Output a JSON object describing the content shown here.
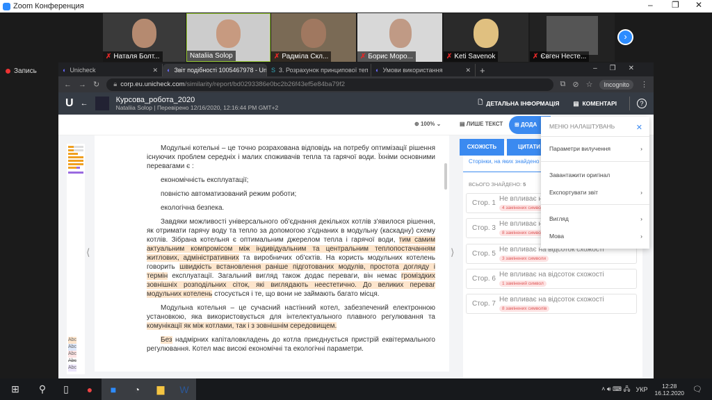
{
  "zoom": {
    "title": "Zoom Конференция",
    "record": "Запись",
    "participants": [
      "Наталя Болт...",
      "Nataliia Solop",
      "Радміла Скл...",
      "Борис Моро...",
      "Keti Savenok",
      "Євген Несте..."
    ]
  },
  "browser": {
    "tabs": [
      {
        "label": "Unicheck"
      },
      {
        "label": "Звіт подібності 1005467978 - Un"
      },
      {
        "label": "3. Розрахунок принципової теп"
      },
      {
        "label": "Умови використання"
      }
    ],
    "url_host": "corp.eu.unicheck.com",
    "url_path": "/similarity/report/bd0293386e0bc2b26f43ef5e84ba79f2",
    "incognito": "Incognito"
  },
  "app": {
    "doc_title": "Курсова_робота_2020",
    "doc_sub": "Nataliia Solop | Перевірено 12/16/2020, 12:16:44 PM GMT+2",
    "details": "ДЕТАЛЬНА ІНФОРМАЦІЯ",
    "comments": "КОМЕНТАРІ",
    "help": "?",
    "zoom_level": "100%",
    "text_only": "ЛИШЕ ТЕКСТ",
    "add": "ДОДА"
  },
  "document": {
    "p1": "Модульні котельні – це точно розрахована відповідь на потребу оптимізації рішення існуючих проблем середніх і малих споживачів тепла та гарячої води. Їхніми основними перевагами є :",
    "li1": "економічність експлуатації;",
    "li2": "повністю автоматизований режим роботи;",
    "li3": "екологічна безпека.",
    "p2a": "Завдяки можливості універсального об'єднання декількох котлів з'явилося рішення, як отримати гарячу воду та тепло за допомогою з'єднаних в модульну (каскадну) схему котлів. Зібрана котельня є оптимальним джерелом тепла і гарячої води, ",
    "p2b": "тим самим актуальним компромісом між індивідуальним та центральним теплопостачанням житлових, адміністративних",
    "p2c": " та виробничих об'єктів. На користь модульних котелень говорить ",
    "p2d": "швидкість встановлення раніше підготованих модулів, простота догляду і термін",
    "p2e": " експлуатації. Загальний вигляд також додає переваги, він немає ",
    "p2f": "громіздких зовнішніх розподільних сіток, які виглядають неестетично. До великих переваг модульних котелень",
    "p2g": " стосується і те, що вони не займають багато місця.",
    "p3a": "Модульна котельня – це сучасний настінний котел, забезпечений електронною установкою, яка використовується для інтелектуального плавного регулювання та ",
    "p3b": "комунікації як між котлами, так і з зовнішнім середовищем.",
    "p4a": "Без",
    "p4b": " надмірних капіталовкладень до котла приєднується пристрій еквітермального регулювання. Котел має високі економічні та екологічні параметри.",
    "legend": [
      "Abc",
      "Abc",
      "Abc",
      "Abc",
      "Abc"
    ]
  },
  "panel": {
    "tab_similarity": "СХОЖІСТЬ",
    "tab_quotes": "ЦИТАТИ",
    "subtitle": "Сторінки, на яких знайдено",
    "total_label": "ВСЬОГО ЗНАЙДЕНО:",
    "total": "5",
    "items": [
      {
        "page": "Стор. 1",
        "text": "Не впливає на відсоток схожості",
        "badge": "4 замінених символи"
      },
      {
        "page": "Стор. 3",
        "text": "Не впливає на відсоток схожості",
        "badge": "8 замінених символів"
      },
      {
        "page": "Стор. 5",
        "text": "Не впливає на відсоток схожості",
        "badge": "3 замінених символи"
      },
      {
        "page": "Стор. 6",
        "text": "Не впливає на відсоток схожості",
        "badge": "1 замінений символ"
      },
      {
        "page": "Стор. 7",
        "text": "Не впливає на відсоток схожості",
        "badge": "8 замінених символів"
      }
    ]
  },
  "menu": {
    "title": "МЕНЮ НАЛАШТУВАНЬ",
    "items": [
      "Параметри вилучення",
      "Завантажити оригінал",
      "Експортувати звіт",
      "Вигляд",
      "Мова"
    ]
  },
  "taskbar": {
    "lang": "УКР",
    "time": "12:28",
    "date": "16.12.2020"
  },
  "colors": {
    "accent": "#3b8af0",
    "highlight": "#fde5cc",
    "badge": "#fde3e3"
  }
}
